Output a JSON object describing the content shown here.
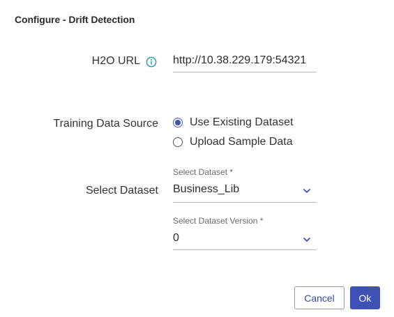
{
  "dialog": {
    "title": "Configure - Drift Detection"
  },
  "h2o_url": {
    "label": "H2O URL",
    "value": "http://10.38.229.179:54321",
    "info_icon": "info-circle-icon"
  },
  "training_data_source": {
    "label": "Training Data Source",
    "options": [
      {
        "label": "Use Existing Dataset",
        "checked": true
      },
      {
        "label": "Upload Sample Data",
        "checked": false
      }
    ]
  },
  "select_dataset": {
    "label": "Select Dataset",
    "dataset_caption": "Select Dataset *",
    "dataset_value": "Business_Lib",
    "version_caption": "Select Dataset Version *",
    "version_value": "0",
    "dropdown_icon": "chevron-down-icon"
  },
  "actions": {
    "cancel_label": "Cancel",
    "ok_label": "Ok"
  },
  "colors": {
    "primary": "#3f51b5",
    "info_icon": "#2aa3a8",
    "text": "#333333"
  }
}
